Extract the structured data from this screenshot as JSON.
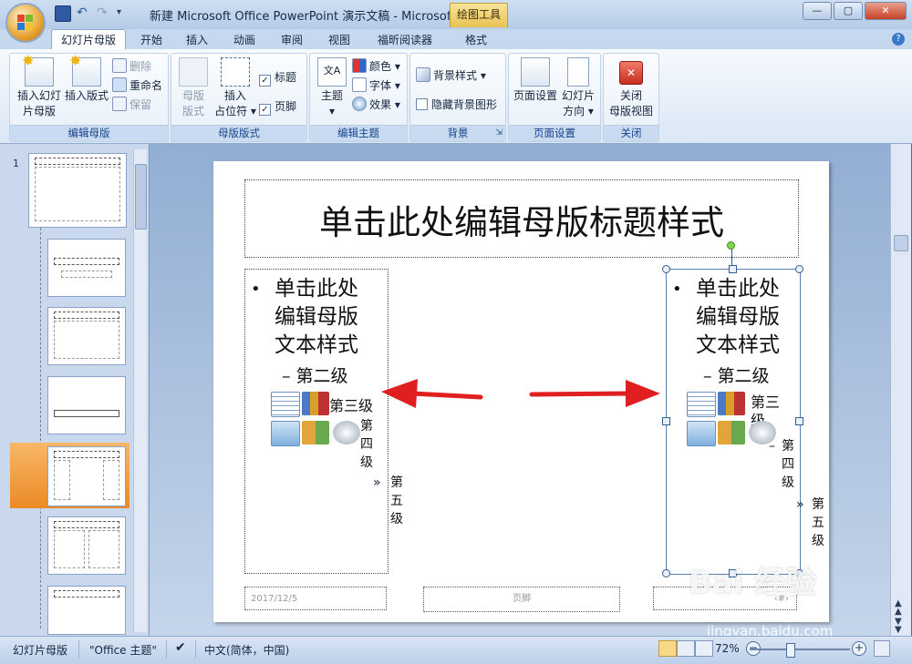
{
  "window": {
    "title": "新建 Microsoft Office PowerPoint 演示文稿 - Microsof...",
    "context_tab": "绘图工具",
    "controls": [
      "—",
      "▢",
      "✕"
    ]
  },
  "tabs": [
    "幻灯片母版",
    "开始",
    "插入",
    "动画",
    "审阅",
    "视图",
    "福昕阅读器",
    "格式"
  ],
  "active_tab": "幻灯片母版",
  "ribbon": {
    "edit_master": {
      "label": "编辑母版",
      "insert_slide_master": "插入幻灯片母版",
      "insert_slide_master_l1": "插入幻灯",
      "insert_slide_master_l2": "片母版",
      "insert_layout": "插入版式",
      "delete": "删除",
      "rename": "重命名",
      "preserve": "保留"
    },
    "master_layout": {
      "label": "母版版式",
      "master_layout_l1": "母版",
      "master_layout_l2": "版式",
      "insert_placeholder_l1": "插入",
      "insert_placeholder_l2": "占位符",
      "title": "标题",
      "footer": "页脚"
    },
    "edit_theme": {
      "label": "编辑主题",
      "theme": "主题",
      "colors": "颜色",
      "fonts": "字体",
      "effects": "效果"
    },
    "background": {
      "label": "背景",
      "background_styles": "背景样式",
      "hide_background": "隐藏背景图形"
    },
    "page_setup": {
      "label": "页面设置",
      "page_setup": "页面设置",
      "orientation_l1": "幻灯片",
      "orientation_l2": "方向"
    },
    "close": {
      "label": "关闭",
      "close_l1": "关闭",
      "close_l2": "母版视图"
    }
  },
  "slides_pane": {
    "slide_number": "1"
  },
  "slide": {
    "title": "单击此处编辑母版标题样式",
    "level1_lines": [
      "单击此处",
      "编辑母版",
      "文本样式"
    ],
    "bullet": "•",
    "level2": "– 第二级",
    "level3": "第三级",
    "level3_wrapped": [
      "第三",
      "级"
    ],
    "level4": [
      "第",
      "四",
      "级"
    ],
    "level5": [
      "第",
      "五",
      "级"
    ],
    "level4_dash": "–",
    "level5_marker": "»",
    "footer_date": "2017/12/5",
    "footer_center": "页脚",
    "footer_right": "‹#›"
  },
  "watermark": {
    "text": "Bai 经验",
    "url": "jingyan.baidu.com"
  },
  "status_bar": {
    "view": "幻灯片母版",
    "theme": "\"Office 主题\"",
    "language": "中文(简体，中国)",
    "zoom": "72%"
  },
  "colors": {
    "accent_arrow": "#e02020",
    "selection_orange": "#eb8a26",
    "ribbon_group_label": "#15428b"
  }
}
